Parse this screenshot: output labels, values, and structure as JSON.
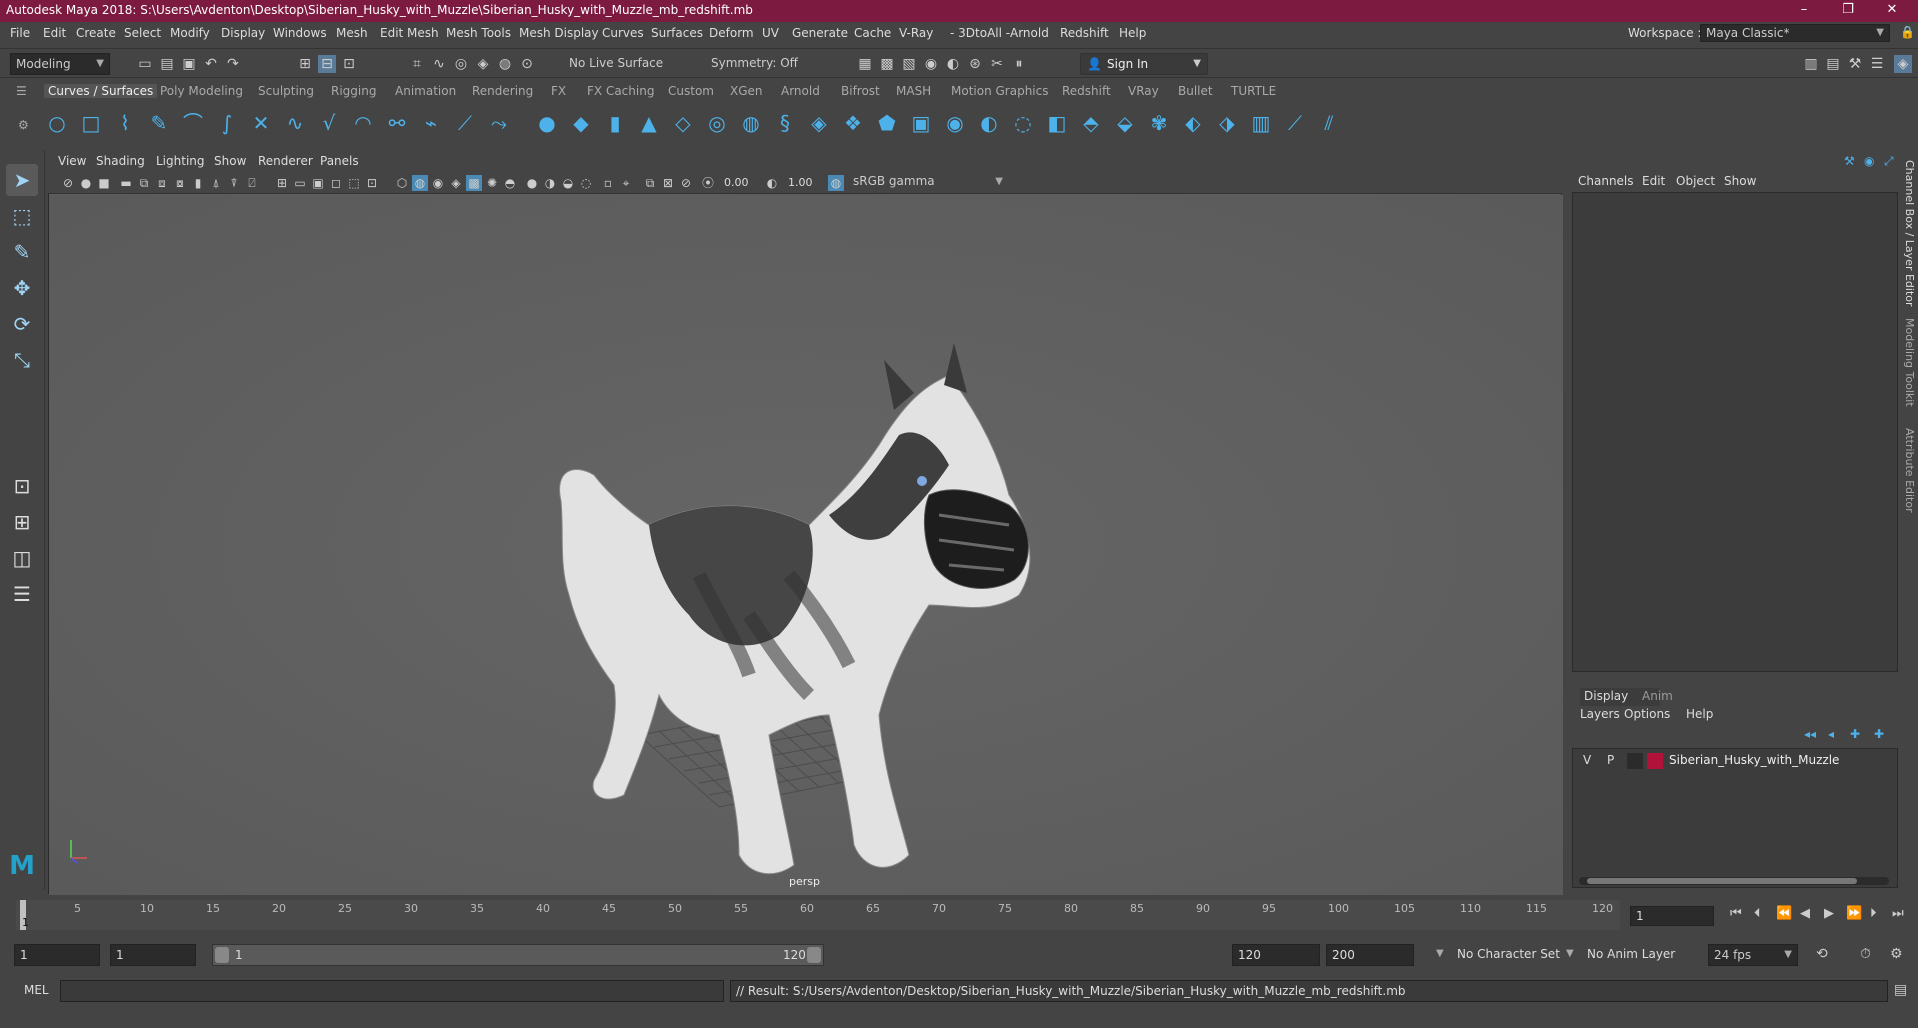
{
  "titlebar": {
    "title": "Autodesk Maya 2018: S:\\Users\\Avdenton\\Desktop\\Siberian_Husky_with_Muzzle\\Siberian_Husky_with_Muzzle_mb_redshift.mb",
    "min": "–",
    "max": "❐",
    "close": "✕"
  },
  "menubar": {
    "items": [
      "File",
      "Edit",
      "Create",
      "Select",
      "Modify",
      "Display",
      "Windows",
      "Mesh",
      "Edit Mesh",
      "Mesh Tools",
      "Mesh Display",
      "Curves",
      "Surfaces",
      "Deform",
      "UV",
      "Generate",
      "Cache",
      "V-Ray",
      "- 3DtoAll -",
      "Arnold",
      "Redshift",
      "Help"
    ],
    "workspace_label": "Workspace :",
    "workspace_value": "Maya Classic*"
  },
  "statusline": {
    "mode": "Modeling",
    "live_surface": "No Live Surface",
    "symmetry": "Symmetry: Off",
    "sign_in": "Sign In"
  },
  "shelf": {
    "tabs": [
      "Curves / Surfaces",
      "Poly Modeling",
      "Sculpting",
      "Rigging",
      "Animation",
      "Rendering",
      "FX",
      "FX Caching",
      "Custom",
      "XGen",
      "Arnold",
      "Bifrost",
      "MASH",
      "Motion Graphics",
      "Redshift",
      "VRay",
      "Bullet",
      "TURTLE"
    ]
  },
  "viewport": {
    "menus": [
      "View",
      "Shading",
      "Lighting",
      "Show",
      "Renderer",
      "Panels"
    ],
    "exposure": "0.00",
    "gamma": "1.00",
    "colorspace": "sRGB gamma",
    "camera_label": "persp"
  },
  "channelbox": {
    "menus": [
      "Channels",
      "Edit",
      "Object",
      "Show"
    ]
  },
  "layereditor": {
    "tabs": [
      "Display",
      "Anim"
    ],
    "menus": [
      "Layers",
      "Options",
      "Help"
    ],
    "layer": {
      "v": "V",
      "p": "P",
      "name": "Siberian_Husky_with_Muzzle",
      "color": "#b0123a"
    }
  },
  "side_tabs": [
    "Channel Box / Layer Editor",
    "Modeling Toolkit",
    "Attribute Editor"
  ],
  "timeline": {
    "ticks": [
      "1",
      "5",
      "10",
      "15",
      "20",
      "25",
      "30",
      "35",
      "40",
      "45",
      "50",
      "55",
      "60",
      "65",
      "70",
      "75",
      "80",
      "85",
      "90",
      "95",
      "100",
      "105",
      "110",
      "115",
      "120"
    ],
    "current_frame": "1"
  },
  "range": {
    "start": "1",
    "start_inner": "1",
    "slider_start": "1",
    "slider_end": "120",
    "end_inner": "120",
    "end": "200",
    "character_set": "No Character Set",
    "anim_layer": "No Anim Layer",
    "fps": "24 fps"
  },
  "cmdline": {
    "lang": "MEL",
    "result": "// Result: S:/Users/Avdenton/Desktop/Siberian_Husky_with_Muzzle/Siberian_Husky_with_Muzzle_mb_redshift.mb"
  },
  "colors": {
    "titlebar": "#7d1a3f",
    "accent": "#4db2ea"
  }
}
